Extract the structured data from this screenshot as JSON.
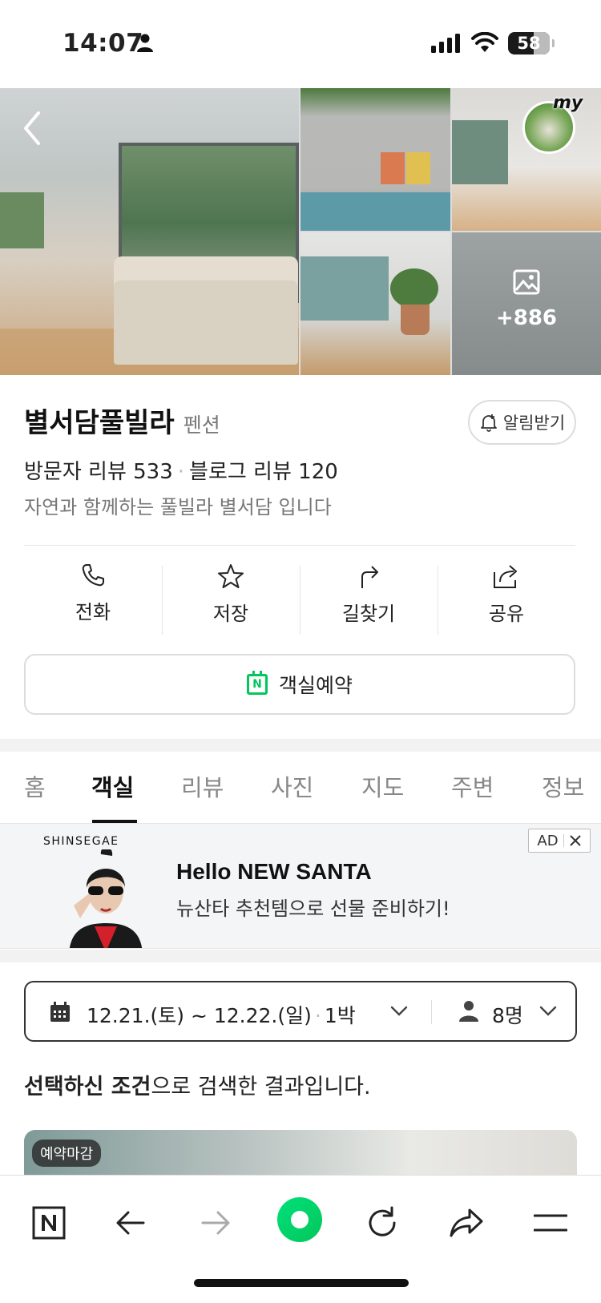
{
  "status_bar": {
    "time": "14:07",
    "battery": "58"
  },
  "gallery": {
    "more_count": "+886",
    "my_label": "my"
  },
  "place": {
    "name": "별서담풀빌라",
    "category": "펜션",
    "alarm_label": "알림받기",
    "visitor_reviews": "방문자 리뷰 533",
    "blog_reviews": "블로그 리뷰 120",
    "description": "자연과 함께하는 풀빌라 별서담 입니다"
  },
  "actions": [
    {
      "label": "전화",
      "icon": "phone-icon"
    },
    {
      "label": "저장",
      "icon": "star-icon"
    },
    {
      "label": "길찾기",
      "icon": "directions-icon"
    },
    {
      "label": "공유",
      "icon": "share-icon"
    }
  ],
  "booking": {
    "label": "객실예약",
    "icon_letter": "N"
  },
  "tabs": [
    "홈",
    "객실",
    "리뷰",
    "사진",
    "지도",
    "주변",
    "정보"
  ],
  "active_tab": "객실",
  "ad": {
    "brand": "SHINSEGAE",
    "headline": "Hello NEW SANTA",
    "sub": "뉴산타 추천템으로 선물 준비하기!",
    "badge": "AD"
  },
  "date_selector": {
    "dates": "12.21.(토) ~ 12.22.(일)",
    "nights": "1박",
    "guests": "8명"
  },
  "result": {
    "bold1": "선택하신 조건",
    "rest": "으로 검색한 결과입니다."
  },
  "room_card": {
    "badge": "예약마감"
  },
  "colors": {
    "naver_green": "#03c75a",
    "text": "#222222",
    "muted": "#777777"
  }
}
